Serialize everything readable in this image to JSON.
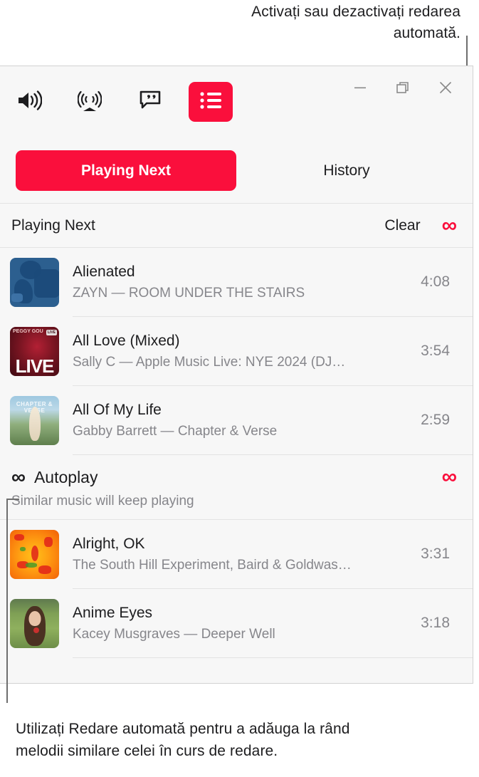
{
  "callouts": {
    "top": "Activați sau dezactivați redarea automată.",
    "bottom": "Utilizați Redare automată pentru a adăuga la rând melodii similare celei în curs de redare."
  },
  "toolbar": {
    "icons": [
      {
        "name": "volume-icon",
        "label": "Volume"
      },
      {
        "name": "airplay-icon",
        "label": "AirPlay"
      },
      {
        "name": "lyrics-icon",
        "label": "Lyrics"
      },
      {
        "name": "queue-icon",
        "label": "Playing Next"
      }
    ],
    "window_controls": [
      {
        "name": "minimize-button",
        "glyph": "—"
      },
      {
        "name": "restore-button",
        "glyph": "❐"
      },
      {
        "name": "close-button",
        "glyph": "✕"
      }
    ]
  },
  "tabs": [
    {
      "label": "Playing Next",
      "active": true
    },
    {
      "label": "History",
      "active": false
    }
  ],
  "queue_header": {
    "title": "Playing Next",
    "clear_label": "Clear",
    "autoplay_toggle": "∞"
  },
  "tracks": [
    {
      "title": "Alienated",
      "subtitle": "ZAYN — ROOM UNDER THE STAIRS",
      "duration": "4:08",
      "art": "art-alienated"
    },
    {
      "title": "All Love (Mixed)",
      "subtitle": "Sally C — Apple Music Live: NYE 2024 (DJ…",
      "duration": "3:54",
      "art": "art-live"
    },
    {
      "title": "All Of My Life",
      "subtitle": "Gabby Barrett — Chapter & Verse",
      "duration": "2:59",
      "art": "art-verse"
    }
  ],
  "autoplay": {
    "icon": "∞",
    "title": "Autoplay",
    "subtitle": "Similar music will keep playing",
    "toggle": "∞"
  },
  "autoplay_tracks": [
    {
      "title": "Alright, OK",
      "subtitle": "The South Hill Experiment, Baird & Goldwas…",
      "duration": "3:31",
      "art": "art-alright"
    },
    {
      "title": "Anime Eyes",
      "subtitle": "Kacey Musgraves — Deeper Well",
      "duration": "3:18",
      "art": "art-anime"
    }
  ],
  "artwork_text": {
    "live_word": "LIVE",
    "peggy": "PEGGY GOU",
    "badge": "LIVE",
    "verse_caption": "CHAPTER & VERSE"
  },
  "colors": {
    "accent": "#fa0f3c",
    "window_bg": "#f7f7f7",
    "divider": "#e3e3e3",
    "secondary_text": "#86868b"
  }
}
